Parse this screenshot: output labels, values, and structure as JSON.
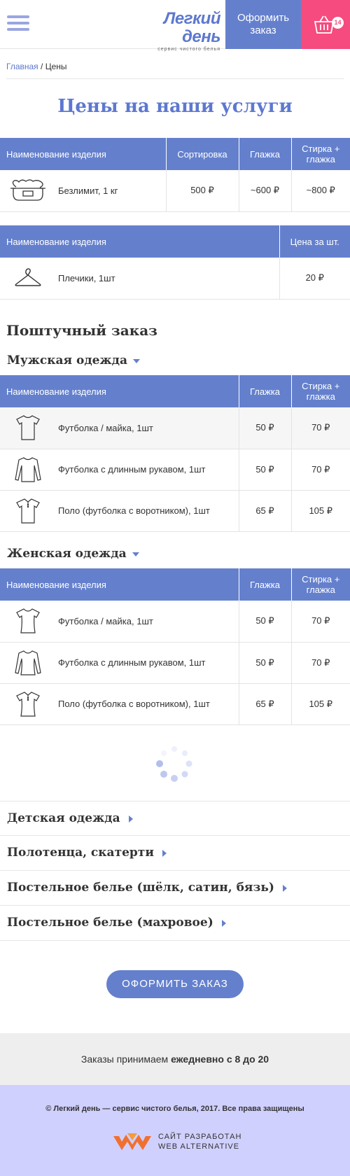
{
  "header": {
    "logo_title": "Легкий день",
    "logo_subtitle": "сервис чистого белья",
    "order_button": "Оформить заказ",
    "cart_count": "14"
  },
  "breadcrumb": {
    "home": "Главная",
    "separator": " / ",
    "current": "Цены"
  },
  "page_title": "Цены на наши услуги",
  "table_bulk": {
    "headers": [
      "Наименование изделия",
      "Сортировка",
      "Глажка",
      "Стирка + глажка"
    ],
    "rows": [
      {
        "name": "Безлимит, 1 кг",
        "icon": "laundry-basket-icon",
        "sort": "500 ₽",
        "iron": "~600 ₽",
        "wash": "~800 ₽"
      }
    ]
  },
  "table_hangers": {
    "headers": [
      "Наименование изделия",
      "Цена за шт."
    ],
    "rows": [
      {
        "name": "Плечики, 1шт",
        "icon": "hanger-icon",
        "price": "20 ₽"
      }
    ]
  },
  "piece_order_title": "Поштучный заказ",
  "men": {
    "title": "Мужская одежда",
    "headers": [
      "Наименование изделия",
      "Глажка",
      "Стирка + глажка"
    ],
    "rows": [
      {
        "name": "Футболка / майка, 1шт",
        "icon": "tshirt-icon",
        "iron": "50 ₽",
        "wash": "70 ₽"
      },
      {
        "name": "Футболка с длинным рукавом, 1шт",
        "icon": "longsleeve-icon",
        "iron": "50 ₽",
        "wash": "70 ₽"
      },
      {
        "name": "Поло (футболка с воротником), 1шт",
        "icon": "polo-icon",
        "iron": "65 ₽",
        "wash": "105 ₽"
      }
    ]
  },
  "women": {
    "title": "Женская одежда",
    "headers": [
      "Наименование изделия",
      "Глажка",
      "Стирка + глажка"
    ],
    "rows": [
      {
        "name": "Футболка / майка, 1шт",
        "icon": "tshirt-icon",
        "iron": "50 ₽",
        "wash": "70 ₽"
      },
      {
        "name": "Футболка с длинным рукавом, 1шт",
        "icon": "longsleeve-icon",
        "iron": "50 ₽",
        "wash": "70 ₽"
      },
      {
        "name": "Поло (футболка с воротником), 1шт",
        "icon": "polo-icon",
        "iron": "65 ₽",
        "wash": "105 ₽"
      }
    ]
  },
  "categories": [
    "Детская одежда",
    "Полотенца, скатерти",
    "Постельное белье (шёлк, сатин, бязь)",
    "Постельное белье (махровое)"
  ],
  "order_button": "ОФОРМИТЬ ЗАКАЗ",
  "schedule": {
    "text": "Заказы  принимаем ",
    "bold": "ежедневно с 8 до 20"
  },
  "footer": {
    "copyright": "© Легкий день — сервис чистого белья, 2017. Все права защищены",
    "dev_line1": "САЙТ РАЗРАБОТАН",
    "dev_line2": "WEB ALTERNATIVE"
  },
  "colors": {
    "accent": "#6480cd",
    "cart": "#f54b7e",
    "footer": "#d0d0ff",
    "schedule": "#eeeeee"
  }
}
